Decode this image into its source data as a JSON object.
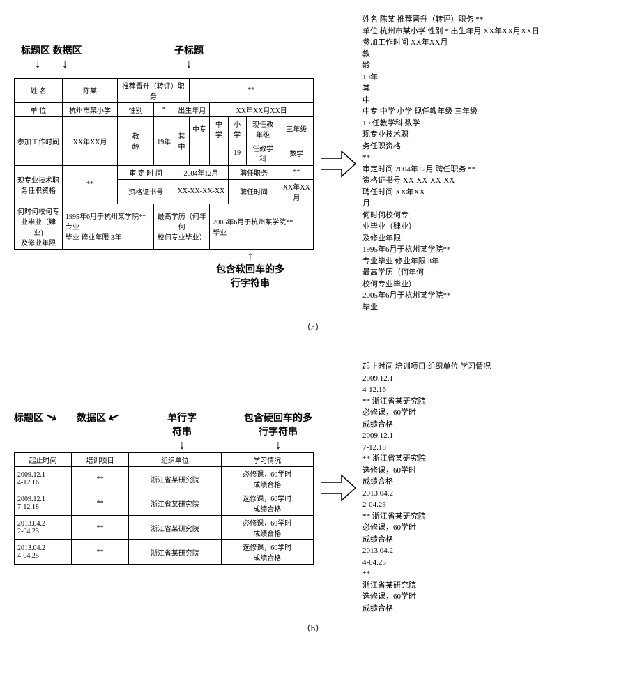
{
  "figA": {
    "annotations": {
      "title_area": "标题区",
      "data_area": "数据区",
      "subtitle": "子标题",
      "multiline_soft": "包含软回车的多\n行字符串"
    },
    "table": {
      "name_lbl": "姓 名",
      "name_val": "陈某",
      "promo_lbl": "推荐晋升（转评）职务",
      "promo_val": "**",
      "unit_lbl": "单 位",
      "unit_val": "杭州市某小学",
      "gender_lbl": "性别",
      "gender_val": "*",
      "birth_lbl": "出生年月",
      "birth_val": "XX年XX月XX日",
      "work_lbl": "参加工作时间",
      "work_val": "XX年XX月",
      "teach_age_lbl": "教\n龄",
      "teach_age_val": "19年",
      "qizhong_lbl": "其\n中",
      "zhongzhuan": "中专",
      "zhongxue": "中学",
      "xiaoxue": "小学",
      "grade_lbl": "现任教年级",
      "grade_val": "三年级",
      "n19": "19",
      "subject_lbl": "任教学科",
      "subject_val": "数学",
      "qual_lbl": "现专业技术职\n务任职资格",
      "qual_val": "**",
      "appr_time_lbl": "审 定 时 间",
      "appr_time_val": "2004年12月",
      "appoint_lbl": "聘任职务",
      "appoint_val": "**",
      "cert_lbl": "资格证书号",
      "cert_val": "XX-XX-XX-XX",
      "appoint_time_lbl": "聘任时间",
      "appoint_time_val": "XX年XX月",
      "grad_lbl": "何时何校何专\n业毕业（肄业)\n及修业年限",
      "grad_val": "1995年6月于杭州某学院**专业\n毕业 修业年限 3年",
      "edu_lbl": "最高学历（何年何\n校何专业毕业）",
      "edu_val": "2005年6月于杭州某学院**\n毕业"
    },
    "output": "姓名 陈某 推荐晋升（转评）职务 **\n单位 杭州市某小学 性别 * 出生年月 XX年XX月XX日\n参加工作时间 XX年XX月\n教\n龄\n19年\n其\n中\n中专 中学 小学 现任教年级 三年级\n 19 任教学科 数学\n现专业技术职\n务任职资格\n**\n审定时间 2004年12月 聘任职务 **\n资格证书号 XX-XX-XX-XX\n聘任时间 XX年XX\n月\n何时何校何专\n业毕业（肄业）\n及修业年限\n1995年6月于杭州某学院**\n专业毕业 修业年限 3年\n最高学历（何年何\n校何专业毕业）\n2005年6月于杭州某学院**\n毕业",
    "label": "（a）"
  },
  "figB": {
    "annotations": {
      "title_area": "标题区",
      "data_area": "数据区",
      "single_line": "单行字\n符串",
      "multiline_hard": "包含硬回车的多\n行字符串"
    },
    "table": {
      "h1": "起止时间",
      "h2": "培训项目",
      "h3": "组织单位",
      "h4": "学习情况",
      "r1c1": "2009.12.1\n4-12.16",
      "r1c2": "**",
      "r1c3": "浙江省某研究院",
      "r1c4": "必修课，60学时\n成绩合格",
      "r2c1": "2009.12.1\n7-12.18",
      "r2c2": "**",
      "r2c3": "浙江省某研究院",
      "r2c4": "选修课，60学时\n成绩合格",
      "r3c1": "2013.04.2\n2-04.23",
      "r3c2": "**",
      "r3c3": "浙江省某研究院",
      "r3c4": "必修课，60学时\n成绩合格",
      "r4c1": "2013.04.2\n4-04.25",
      "r4c2": "**",
      "r4c3": "浙江省某研究院",
      "r4c4": "选修课，60学时\n成绩合格"
    },
    "output": "起止时间 培训项目 组织单位 学习情况\n2009.12.1\n4-12.16\n** 浙江省某研究院\n必修课，60学时\n成绩合格\n2009.12.1\n7-12.18\n** 浙江省某研究院\n选修课，60学时\n成绩合格\n2013.04.2\n2-04.23\n** 浙江省某研究院\n必修课，60学时\n成绩合格\n2013.04.2\n4-04.25\n**\n浙江省某研究院\n选修课，60学时\n成绩合格",
    "label": "（b）"
  }
}
